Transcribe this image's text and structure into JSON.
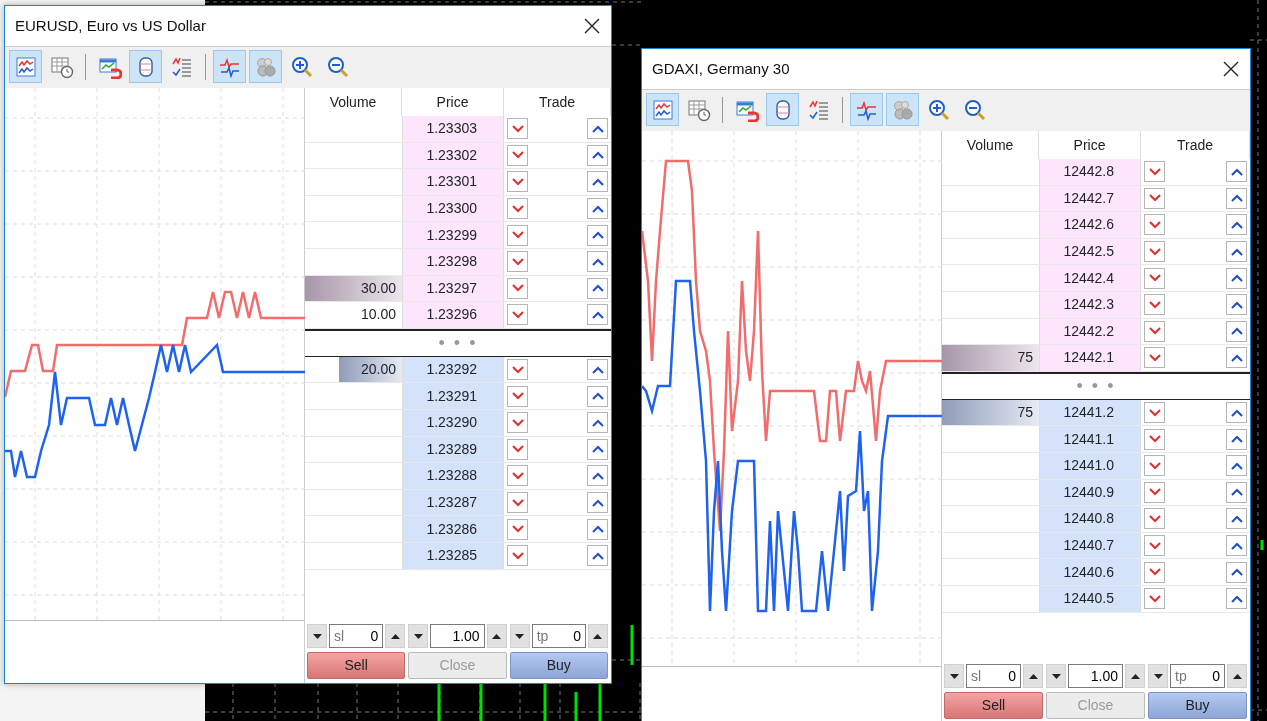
{
  "windows": [
    {
      "title": "EURUSD, Euro vs US Dollar",
      "toolbar": [
        [
          {
            "kind": "chart",
            "selected": true
          },
          {
            "kind": "timetable",
            "selected": false
          }
        ],
        [
          {
            "kind": "magnet",
            "selected": false
          },
          {
            "kind": "depth",
            "selected": true
          },
          {
            "kind": "signals",
            "selected": false
          }
        ],
        [
          {
            "kind": "ticks",
            "selected": true
          },
          {
            "kind": "circles",
            "selected": true
          },
          {
            "kind": "zoom_in",
            "selected": false
          },
          {
            "kind": "zoom_out",
            "selected": false
          }
        ]
      ],
      "columns": [
        "Volume",
        "Price",
        "Trade"
      ],
      "asks": [
        {
          "price": "1.23303"
        },
        {
          "price": "1.23302"
        },
        {
          "price": "1.23301"
        },
        {
          "price": "1.23300"
        },
        {
          "price": "1.23299"
        },
        {
          "price": "1.23298"
        },
        {
          "volume": "30.00",
          "level": 1,
          "price": "1.23297"
        },
        {
          "volume": "10.00",
          "price": "1.23296"
        }
      ],
      "separator": "• • •",
      "bids": [
        {
          "volume": "20.00",
          "level": 0.65,
          "price": "1.23292"
        },
        {
          "price": "1.23291"
        },
        {
          "price": "1.23290"
        },
        {
          "price": "1.23289"
        },
        {
          "price": "1.23288"
        },
        {
          "price": "1.23287"
        },
        {
          "price": "1.23286"
        },
        {
          "price": "1.23285"
        }
      ],
      "sl": {
        "label": "sl",
        "value": "0"
      },
      "lot": {
        "value": "1.00"
      },
      "tp": {
        "label": "tp",
        "value": "0"
      },
      "buttons": [
        {
          "label": "Sell",
          "kind": "sell",
          "disabled": false
        },
        {
          "label": "Close",
          "kind": "close",
          "disabled": true
        },
        {
          "label": "Buy",
          "kind": "buy",
          "disabled": false
        }
      ]
    },
    {
      "title": "GDAXI, Germany 30",
      "toolbar": [
        [
          {
            "kind": "chart",
            "selected": true
          },
          {
            "kind": "timetable",
            "selected": false
          }
        ],
        [
          {
            "kind": "magnet",
            "selected": false
          },
          {
            "kind": "depth",
            "selected": true
          },
          {
            "kind": "signals",
            "selected": false
          }
        ],
        [
          {
            "kind": "ticks",
            "selected": true
          },
          {
            "kind": "circles",
            "selected": true
          },
          {
            "kind": "zoom_in",
            "selected": false
          },
          {
            "kind": "zoom_out",
            "selected": false
          }
        ]
      ],
      "columns": [
        "Volume",
        "Price",
        "Trade"
      ],
      "asks": [
        {
          "price": "12442.8"
        },
        {
          "price": "12442.7"
        },
        {
          "price": "12442.6"
        },
        {
          "price": "12442.5"
        },
        {
          "price": "12442.4"
        },
        {
          "price": "12442.3"
        },
        {
          "price": "12442.2"
        },
        {
          "volume": "75",
          "level": 1,
          "price": "12442.1"
        }
      ],
      "separator": "• • •",
      "bids": [
        {
          "volume": "75",
          "level": 1,
          "price": "12441.2"
        },
        {
          "price": "12441.1"
        },
        {
          "price": "12441.0"
        },
        {
          "price": "12440.9"
        },
        {
          "price": "12440.8"
        },
        {
          "price": "12440.7"
        },
        {
          "price": "12440.6"
        },
        {
          "price": "12440.5"
        }
      ],
      "sl": {
        "label": "sl",
        "value": "0"
      },
      "lot": {
        "value": "1.00"
      },
      "tp": {
        "label": "tp",
        "value": "0"
      },
      "buttons": [
        {
          "label": "Sell",
          "kind": "sell",
          "disabled": false
        },
        {
          "label": "Close",
          "kind": "close",
          "disabled": true
        },
        {
          "label": "Buy",
          "kind": "buy",
          "disabled": false
        }
      ]
    }
  ]
}
